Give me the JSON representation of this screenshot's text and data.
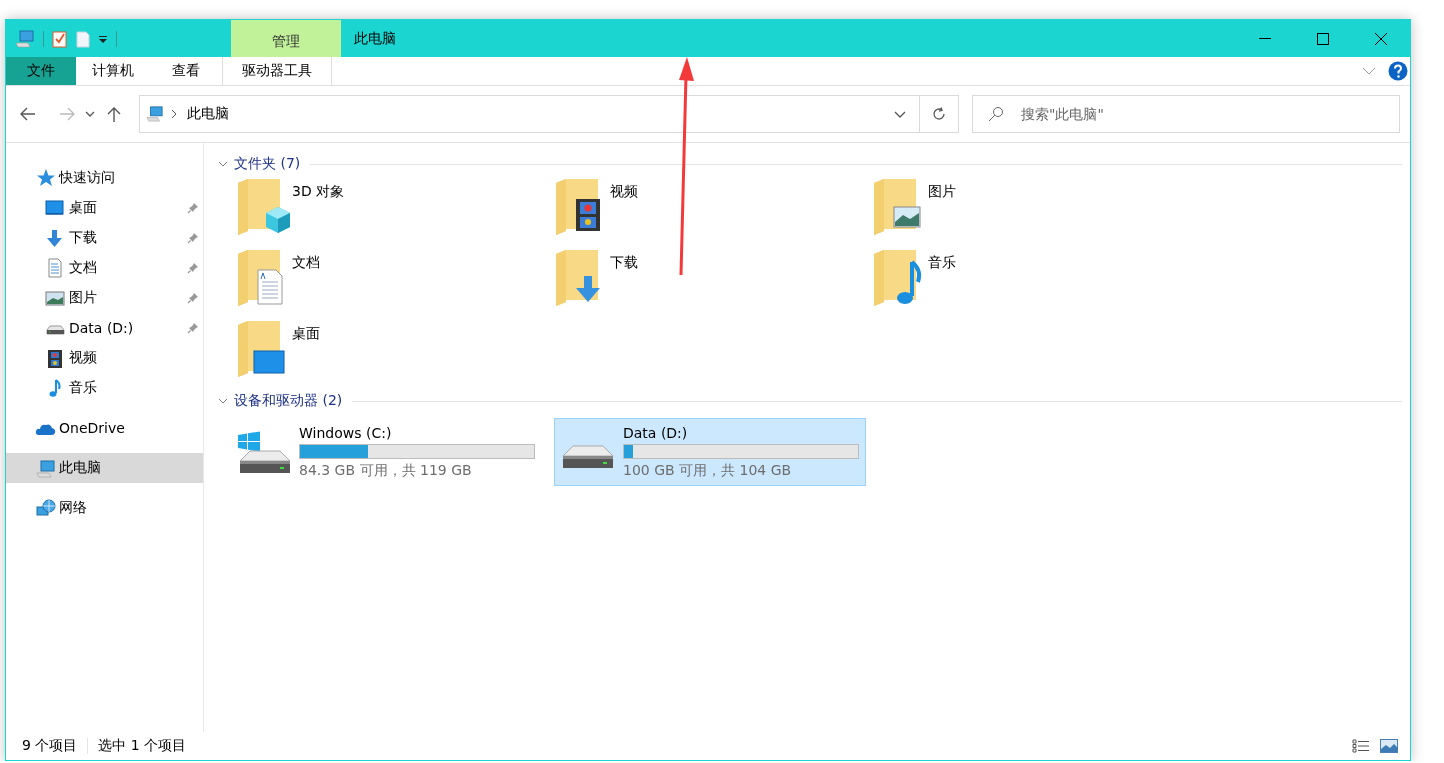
{
  "window": {
    "title": "此电脑",
    "contextual_tab": "管理"
  },
  "ribbon_tabs": [
    {
      "label": "文件",
      "kind": "file"
    },
    {
      "label": "计算机",
      "kind": "normal"
    },
    {
      "label": "查看",
      "kind": "normal"
    },
    {
      "label": "驱动器工具",
      "kind": "contextual"
    }
  ],
  "address_bar": {
    "path": "此电脑"
  },
  "search": {
    "placeholder": "搜索\"此电脑\""
  },
  "sidebar": {
    "items": [
      {
        "label": "快速访问",
        "kind": "star",
        "selected": false,
        "children": [
          {
            "label": "桌面",
            "kind": "desktop",
            "pinned": true,
            "selected": false
          },
          {
            "label": "下载",
            "kind": "download",
            "pinned": true,
            "selected": false
          },
          {
            "label": "文档",
            "kind": "document",
            "pinned": true,
            "selected": false
          },
          {
            "label": "图片",
            "kind": "picture",
            "pinned": true,
            "selected": false
          },
          {
            "label": "Data (D:)",
            "kind": "drive",
            "pinned": true,
            "selected": false
          },
          {
            "label": "视频",
            "kind": "video",
            "pinned": false,
            "selected": false
          },
          {
            "label": "音乐",
            "kind": "music",
            "pinned": false,
            "selected": false
          }
        ]
      },
      {
        "label": "OneDrive",
        "kind": "cloud",
        "selected": false
      },
      {
        "label": "此电脑",
        "kind": "pc",
        "selected": true
      },
      {
        "label": "网络",
        "kind": "network",
        "selected": false
      }
    ]
  },
  "sections": [
    {
      "title": "文件夹 (7)",
      "kind": "folders",
      "expanded": true,
      "items": [
        {
          "name": "3D 对象",
          "kind": "cube"
        },
        {
          "name": "视频",
          "kind": "video"
        },
        {
          "name": "图片",
          "kind": "picture"
        },
        {
          "name": "文档",
          "kind": "document"
        },
        {
          "name": "下载",
          "kind": "download"
        },
        {
          "name": "音乐",
          "kind": "music"
        },
        {
          "name": "桌面",
          "kind": "desktop"
        }
      ]
    },
    {
      "title": "设备和驱动器 (2)",
      "kind": "drives",
      "expanded": true,
      "items": [
        {
          "name": "Windows (C:)",
          "kind": "system",
          "level": 0.29,
          "reading": "84.3 GB 可用，共 119 GB",
          "selected": false
        },
        {
          "name": "Data (D:)",
          "kind": "data",
          "level": 0.04,
          "reading": "100 GB 可用，共 104 GB",
          "selected": true
        }
      ]
    }
  ],
  "status_bar": {
    "item_count": "9 个项目",
    "selection": "选中 1 个项目"
  }
}
